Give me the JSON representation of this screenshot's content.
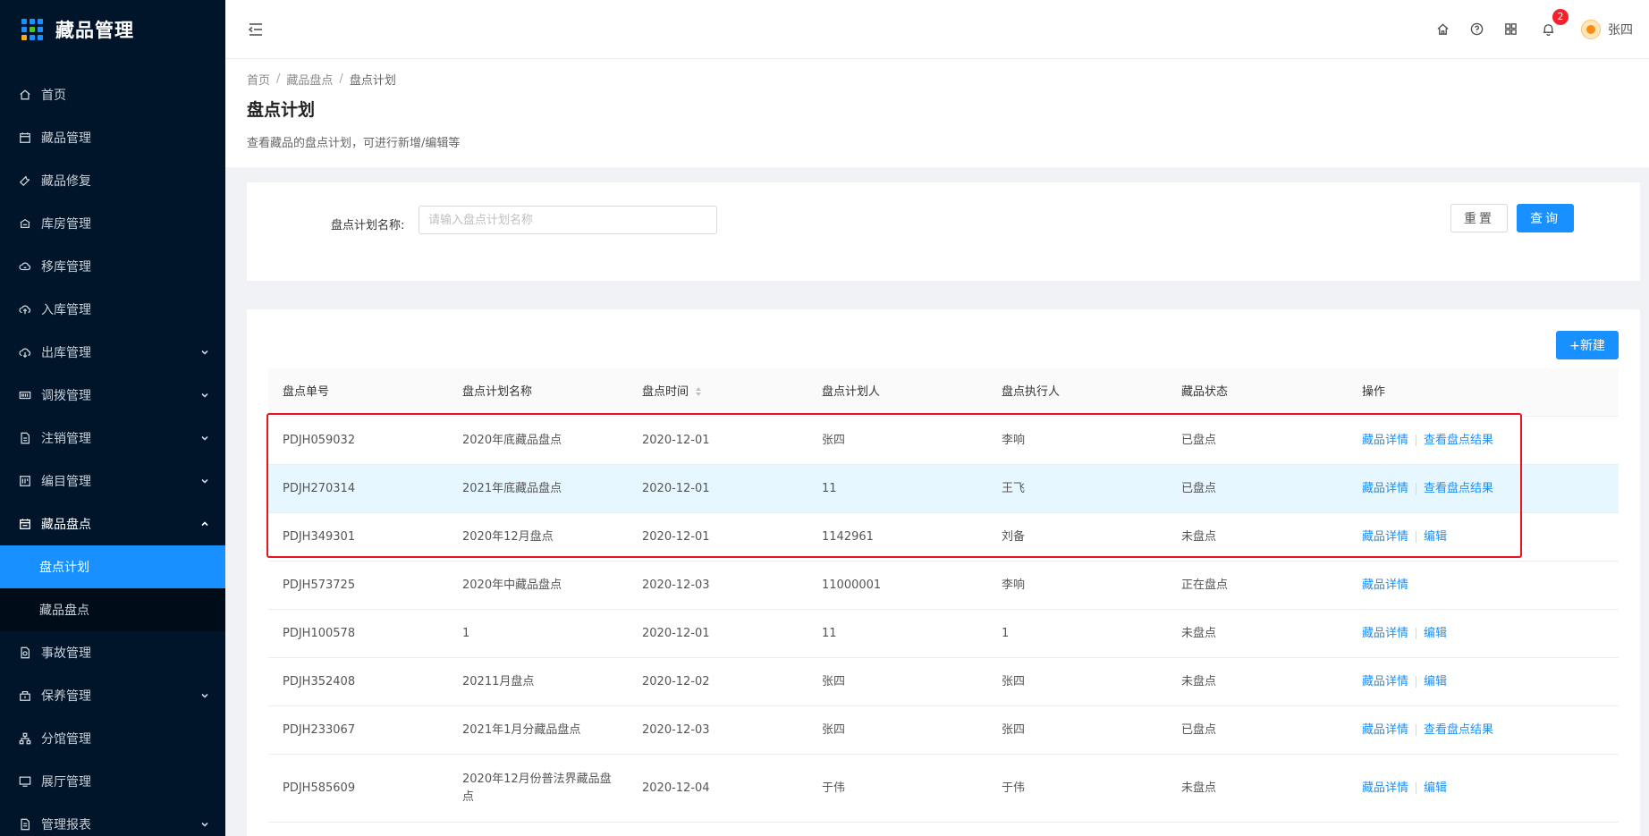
{
  "app": {
    "title": "藏品管理"
  },
  "sidebar": {
    "items": [
      {
        "label": "首页",
        "icon": "home-icon",
        "arrow": ""
      },
      {
        "label": "藏品管理",
        "icon": "calendar-icon",
        "arrow": ""
      },
      {
        "label": "藏品修复",
        "icon": "wrench-icon",
        "arrow": ""
      },
      {
        "label": "库房管理",
        "icon": "warehouse-icon",
        "arrow": ""
      },
      {
        "label": "移库管理",
        "icon": "cloud-transfer-icon",
        "arrow": ""
      },
      {
        "label": "入库管理",
        "icon": "cloud-upload-icon",
        "arrow": ""
      },
      {
        "label": "出库管理",
        "icon": "cloud-download-icon",
        "arrow": "down"
      },
      {
        "label": "调拨管理",
        "icon": "barcode-icon",
        "arrow": "down"
      },
      {
        "label": "注销管理",
        "icon": "file-icon",
        "arrow": "down"
      },
      {
        "label": "编目管理",
        "icon": "catalog-icon",
        "arrow": "down"
      },
      {
        "label": "藏品盘点",
        "icon": "inventory-icon",
        "arrow": "up"
      },
      {
        "label": "事故管理",
        "icon": "incident-icon",
        "arrow": ""
      },
      {
        "label": "保养管理",
        "icon": "maintenance-icon",
        "arrow": "down"
      },
      {
        "label": "分馆管理",
        "icon": "branch-icon",
        "arrow": ""
      },
      {
        "label": "展厅管理",
        "icon": "monitor-icon",
        "arrow": ""
      },
      {
        "label": "管理报表",
        "icon": "report-icon",
        "arrow": "down"
      }
    ],
    "submenu": [
      {
        "label": "盘点计划",
        "active": true
      },
      {
        "label": "藏品盘点",
        "active": false
      }
    ]
  },
  "header": {
    "notification_count": "2",
    "user_name": "张四"
  },
  "breadcrumb": {
    "items": [
      "首页",
      "藏品盘点",
      "盘点计划"
    ],
    "separator": "/"
  },
  "page": {
    "title": "盘点计划",
    "description": "查看藏品的盘点计划，可进行新增/编辑等"
  },
  "search": {
    "label": "盘点计划名称:",
    "placeholder": "请输入盘点计划名称",
    "value": "",
    "reset_label": "重置",
    "query_label": "查询"
  },
  "toolbar": {
    "new_label": "+新建"
  },
  "table": {
    "columns": [
      "盘点单号",
      "盘点计划名称",
      "盘点时间",
      "盘点计划人",
      "盘点执行人",
      "藏品状态",
      "操作"
    ],
    "rows": [
      {
        "id": "PDJH059032",
        "name": "2020年底藏品盘点",
        "date": "2020-12-01",
        "planner": "张四",
        "executor": "李响",
        "status": "已盘点",
        "actions": [
          "藏品详情",
          "查看盘点结果"
        ]
      },
      {
        "id": "PDJH270314",
        "name": "2021年底藏品盘点",
        "date": "2020-12-01",
        "planner": "11",
        "executor": "王飞",
        "status": "已盘点",
        "actions": [
          "藏品详情",
          "查看盘点结果"
        ]
      },
      {
        "id": "PDJH349301",
        "name": "2020年12月盘点",
        "date": "2020-12-01",
        "planner": "1142961",
        "executor": "刘备",
        "status": "未盘点",
        "actions": [
          "藏品详情",
          "编辑"
        ]
      },
      {
        "id": "PDJH573725",
        "name": "2020年中藏品盘点",
        "date": "2020-12-03",
        "planner": "11000001",
        "executor": "李响",
        "status": "正在盘点",
        "actions": [
          "藏品详情"
        ]
      },
      {
        "id": "PDJH100578",
        "name": "1",
        "date": "2020-12-01",
        "planner": "11",
        "executor": "1",
        "status": "未盘点",
        "actions": [
          "藏品详情",
          "编辑"
        ]
      },
      {
        "id": "PDJH352408",
        "name": "20211月盘点",
        "date": "2020-12-02",
        "planner": "张四",
        "executor": "张四",
        "status": "未盘点",
        "actions": [
          "藏品详情",
          "编辑"
        ]
      },
      {
        "id": "PDJH233067",
        "name": "2021年1月分藏品盘点",
        "date": "2020-12-03",
        "planner": "张四",
        "executor": "张四",
        "status": "已盘点",
        "actions": [
          "藏品详情",
          "查看盘点结果"
        ]
      },
      {
        "id": "PDJH585609",
        "name": "2020年12月份普法界藏品盘点",
        "date": "2020-12-04",
        "planner": "于伟",
        "executor": "于伟",
        "status": "未盘点",
        "actions": [
          "藏品详情",
          "编辑"
        ]
      }
    ]
  },
  "colors": {
    "sidebar_bg": "#001529",
    "accent": "#1890ff",
    "highlight_border": "#e8141e",
    "badge": "#f5222d"
  }
}
